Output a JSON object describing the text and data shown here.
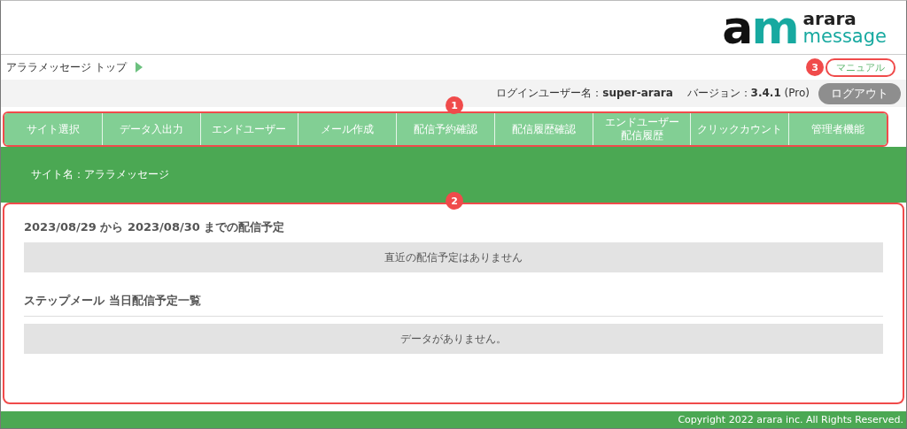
{
  "logo": {
    "mark": [
      {
        "text": "a",
        "color": "#111111"
      },
      {
        "text": "m",
        "color": "#17a9a0"
      }
    ],
    "line1": "arara",
    "line2": "message"
  },
  "breadcrumb": "アララメッセージ トップ",
  "manual_link": "マニュアル",
  "user_info": {
    "label": "ログインユーザー名：",
    "username": "super-arara",
    "version_label": "バージョン：",
    "version": "3.4.1",
    "edition": "(Pro)"
  },
  "logout_button": "ログアウト",
  "nav": [
    {
      "lines": [
        "サイト選択"
      ]
    },
    {
      "lines": [
        "データ入出力"
      ]
    },
    {
      "lines": [
        "エンドユーザー"
      ]
    },
    {
      "lines": [
        "メール作成"
      ]
    },
    {
      "lines": [
        "配信予約確認"
      ]
    },
    {
      "lines": [
        "配信履歴確認"
      ]
    },
    {
      "lines": [
        "エンドユーザー",
        "配信履歴"
      ]
    },
    {
      "lines": [
        "クリックカウント"
      ]
    },
    {
      "lines": [
        "管理者機能"
      ]
    }
  ],
  "site_name": "サイト名：アララメッセージ",
  "sections": [
    {
      "title": "2023/08/29 から 2023/08/30 までの配信予定",
      "ruled": false,
      "message": "直近の配信予定はありません"
    },
    {
      "title": "ステップメール 当日配信予定一覧",
      "ruled": true,
      "message": "データがありません。"
    }
  ],
  "footer": "Copyright 2022 arara inc. All Rights Reserved.",
  "callouts": {
    "nav": "1",
    "content": "2",
    "manual": "3"
  }
}
